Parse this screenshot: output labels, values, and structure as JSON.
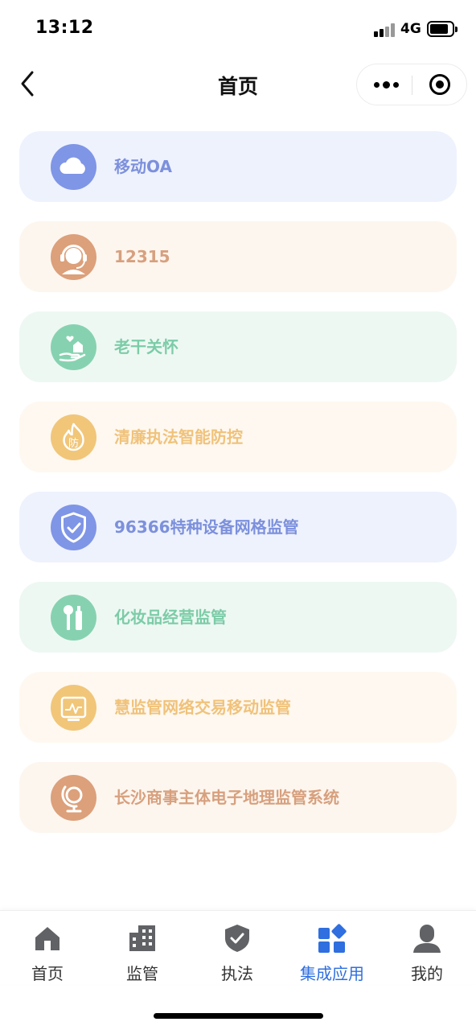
{
  "status_bar": {
    "time": "13:12",
    "network": "4G"
  },
  "nav": {
    "title": "首页"
  },
  "apps": [
    {
      "label": "移动OA",
      "icon": "cloud-icon",
      "icon_color": "#7f95e6",
      "label_color": "#7c90dc",
      "bg_color": "#eef2fd"
    },
    {
      "label": "12315",
      "icon": "customer-service-headset-icon",
      "icon_color": "#dca07a",
      "label_color": "#d7a07e",
      "bg_color": "#fdf6ef"
    },
    {
      "label": "老干关怀",
      "icon": "caring-hand-heart-icon",
      "icon_color": "#86d2b0",
      "label_color": "#7ccca7",
      "bg_color": "#eef8f3"
    },
    {
      "label": "清廉执法智能防控",
      "icon": "fire-prevention-icon",
      "icon_color": "#f1c679",
      "label_color": "#f0c27a",
      "bg_color": "#fef8f0"
    },
    {
      "label": "96366特种设备网格监管",
      "icon": "shield-check-icon",
      "icon_color": "#7f95e6",
      "label_color": "#7c90dc",
      "bg_color": "#eef2fd"
    },
    {
      "label": "化妆品经营监管",
      "icon": "cosmetics-icon",
      "icon_color": "#86d2b0",
      "label_color": "#7ccca7",
      "bg_color": "#eef8f3"
    },
    {
      "label": "慧监管网络交易移动监管",
      "icon": "monitor-chart-icon",
      "icon_color": "#f1c679",
      "label_color": "#f0c27a",
      "bg_color": "#fef8f0"
    },
    {
      "label": "长沙商事主体电子地理监管系统",
      "icon": "globe-icon",
      "icon_color": "#dca07a",
      "label_color": "#d7a07e",
      "bg_color": "#fdf6ef"
    }
  ],
  "tabs": [
    {
      "label": "首页",
      "icon": "home-icon",
      "active": false
    },
    {
      "label": "监管",
      "icon": "building-icon",
      "active": false
    },
    {
      "label": "执法",
      "icon": "shield-check-icon",
      "active": false
    },
    {
      "label": "集成应用",
      "icon": "apps-grid-icon",
      "active": true
    },
    {
      "label": "我的",
      "icon": "user-icon",
      "active": false
    }
  ],
  "colors": {
    "tab_inactive": "#606266",
    "tab_active": "#2f6fdf"
  }
}
